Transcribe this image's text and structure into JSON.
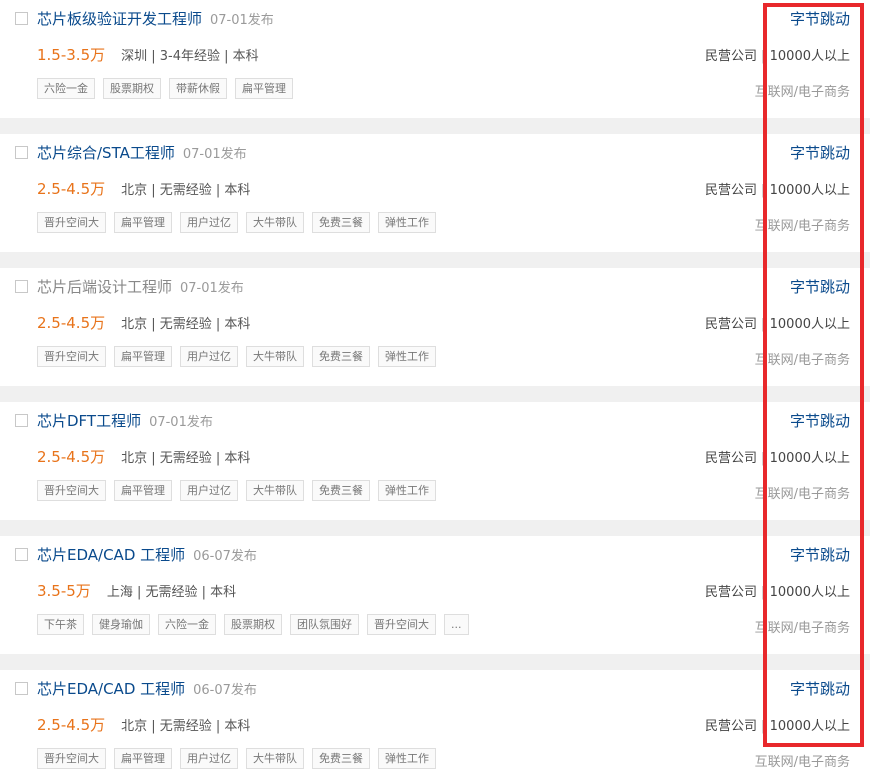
{
  "jobs": [
    {
      "title": "芯片板级验证开发工程师",
      "date": "07-01发布",
      "salary": "1.5-3.5万",
      "requirements": "深圳 | 3-4年经验 | 本科",
      "company": "字节跳动",
      "company_meta": "民营公司 | 10000人以上",
      "industry": "互联网/电子商务",
      "tags": [
        "六险一金",
        "股票期权",
        "带薪休假",
        "扁平管理"
      ]
    },
    {
      "title": "芯片综合/STA工程师",
      "date": "07-01发布",
      "salary": "2.5-4.5万",
      "requirements": "北京 | 无需经验 | 本科",
      "company": "字节跳动",
      "company_meta": "民营公司 | 10000人以上",
      "industry": "互联网/电子商务",
      "tags": [
        "晋升空间大",
        "扁平管理",
        "用户过亿",
        "大牛带队",
        "免费三餐",
        "弹性工作"
      ]
    },
    {
      "title": "芯片后端设计工程师",
      "date": "07-01发布",
      "salary": "2.5-4.5万",
      "requirements": "北京 | 无需经验 | 本科",
      "company": "字节跳动",
      "company_meta": "民营公司 | 10000人以上",
      "industry": "互联网/电子商务",
      "tags": [
        "晋升空间大",
        "扁平管理",
        "用户过亿",
        "大牛带队",
        "免费三餐",
        "弹性工作"
      ]
    },
    {
      "title": "芯片DFT工程师",
      "date": "07-01发布",
      "salary": "2.5-4.5万",
      "requirements": "北京 | 无需经验 | 本科",
      "company": "字节跳动",
      "company_meta": "民营公司 | 10000人以上",
      "industry": "互联网/电子商务",
      "tags": [
        "晋升空间大",
        "扁平管理",
        "用户过亿",
        "大牛带队",
        "免费三餐",
        "弹性工作"
      ]
    },
    {
      "title": "芯片EDA/CAD 工程师",
      "date": "06-07发布",
      "salary": "3.5-5万",
      "requirements": "上海 | 无需经验 | 本科",
      "company": "字节跳动",
      "company_meta": "民营公司 | 10000人以上",
      "industry": "互联网/电子商务",
      "tags": [
        "下午茶",
        "健身瑜伽",
        "六险一金",
        "股票期权",
        "团队氛围好",
        "晋升空间大",
        "..."
      ]
    },
    {
      "title": "芯片EDA/CAD 工程师",
      "date": "06-07发布",
      "salary": "2.5-4.5万",
      "requirements": "北京 | 无需经验 | 本科",
      "company": "字节跳动",
      "company_meta": "民营公司 | 10000人以上",
      "industry": "互联网/电子商务",
      "tags": [
        "晋升空间大",
        "扁平管理",
        "用户过亿",
        "大牛带队",
        "免费三餐",
        "弹性工作"
      ]
    }
  ],
  "colors": {
    "title": "#0a4a8c",
    "salary": "#e8731a",
    "highlight_border": "#e8282b"
  }
}
